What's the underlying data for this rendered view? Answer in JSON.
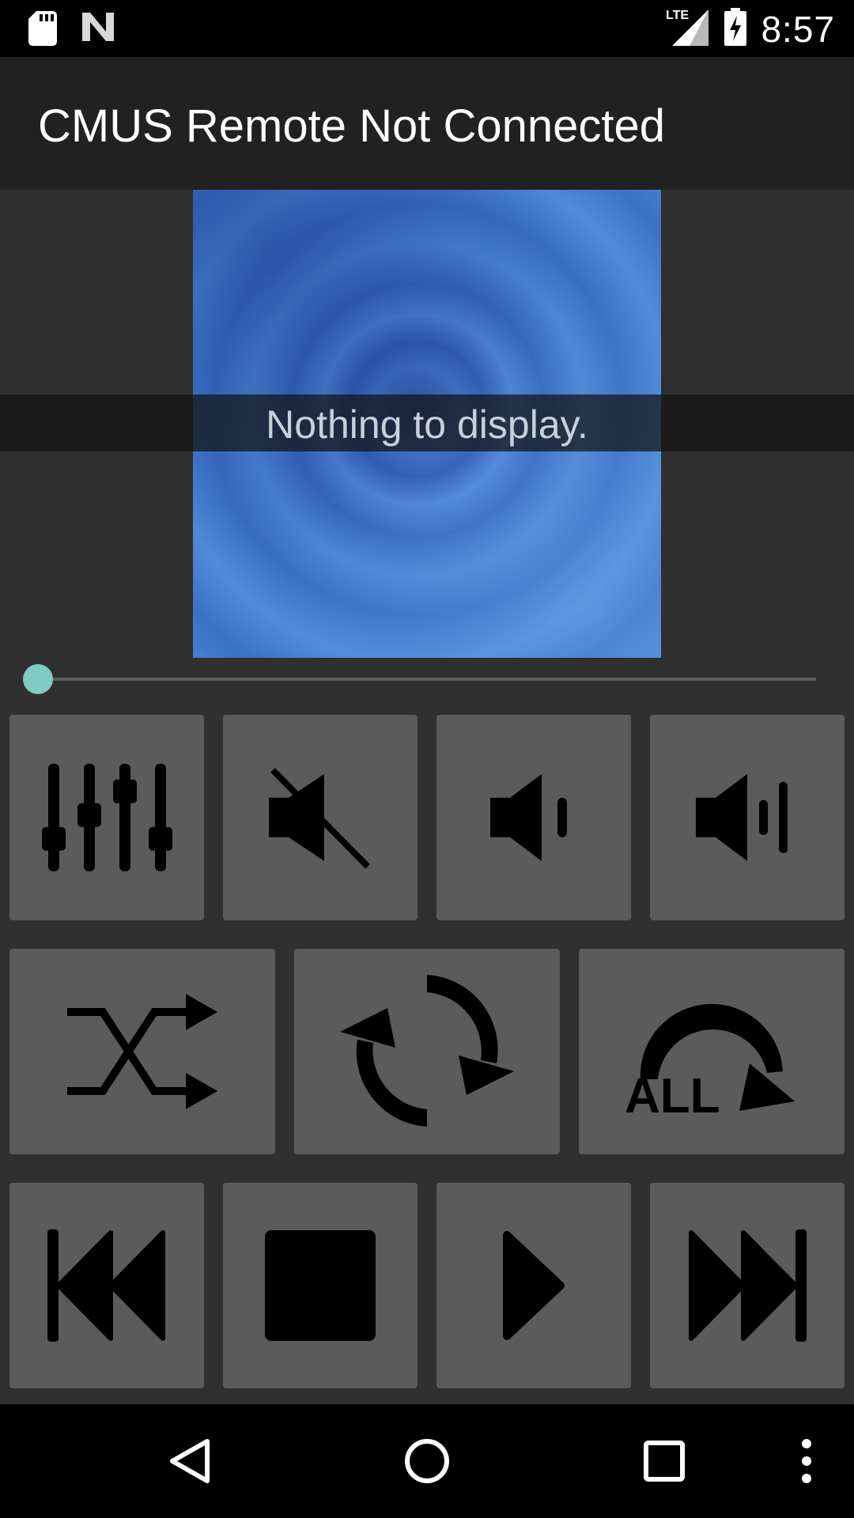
{
  "status_bar": {
    "time": "8:57",
    "network": "LTE",
    "icons": [
      "sd-card-icon",
      "n-logo-icon",
      "lte-signal-icon",
      "battery-charging-icon"
    ]
  },
  "app_bar": {
    "title": "CMUS Remote Not Connected"
  },
  "player": {
    "empty_message": "Nothing to display.",
    "seek_progress": 0.0
  },
  "controls": {
    "row1": [
      "equalizer-icon",
      "mute-icon",
      "volume-down-icon",
      "volume-up-icon"
    ],
    "row2": [
      "shuffle-icon",
      "repeat-icon",
      "repeat-all-icon"
    ],
    "row2_repeat_all_label": "ALL",
    "row3": [
      "previous-icon",
      "stop-icon",
      "play-icon",
      "next-icon"
    ]
  },
  "navigation": {
    "items": [
      "back-icon",
      "home-icon",
      "recents-icon",
      "more-icon"
    ]
  },
  "colors": {
    "status_bar": "#000000",
    "app_bar": "#212121",
    "background": "#303030",
    "button": "#5b5b5b",
    "seek_thumb": "#80cbc4"
  }
}
